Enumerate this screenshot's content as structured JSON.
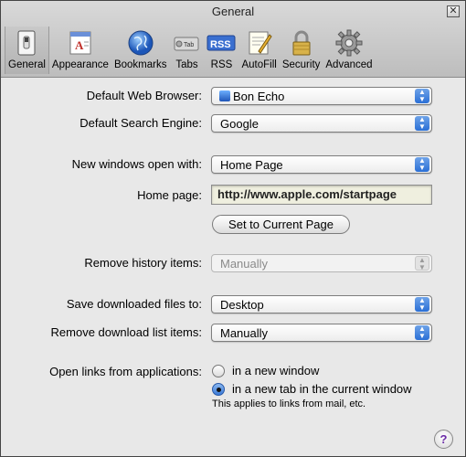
{
  "window": {
    "title": "General"
  },
  "toolbar": {
    "items": [
      {
        "label": "General",
        "icon": "switch-icon",
        "selected": true
      },
      {
        "label": "Appearance",
        "icon": "appearance-icon"
      },
      {
        "label": "Bookmarks",
        "icon": "globe-icon"
      },
      {
        "label": "Tabs",
        "icon": "tabs-icon"
      },
      {
        "label": "RSS",
        "icon": "rss-icon"
      },
      {
        "label": "AutoFill",
        "icon": "autofill-icon"
      },
      {
        "label": "Security",
        "icon": "lock-icon"
      },
      {
        "label": "Advanced",
        "icon": "gear-icon"
      }
    ]
  },
  "form": {
    "default_browser": {
      "label": "Default Web Browser:",
      "value": "Bon Echo"
    },
    "search_engine": {
      "label": "Default Search Engine:",
      "value": "Google"
    },
    "new_windows": {
      "label": "New windows open with:",
      "value": "Home Page"
    },
    "home_page": {
      "label": "Home page:",
      "value": "http://www.apple.com/startpage"
    },
    "set_current_button": "Set to Current Page",
    "remove_history": {
      "label": "Remove history items:",
      "value": "Manually"
    },
    "save_downloads": {
      "label": "Save downloaded files to:",
      "value": "Desktop"
    },
    "remove_download_list": {
      "label": "Remove download list items:",
      "value": "Manually"
    },
    "open_links": {
      "label": "Open links from applications:",
      "option_window": "in a new window",
      "option_tab": "in a new tab in the current window",
      "selected": "option_tab",
      "note": "This applies to links from mail, etc."
    }
  },
  "help_label": "?"
}
